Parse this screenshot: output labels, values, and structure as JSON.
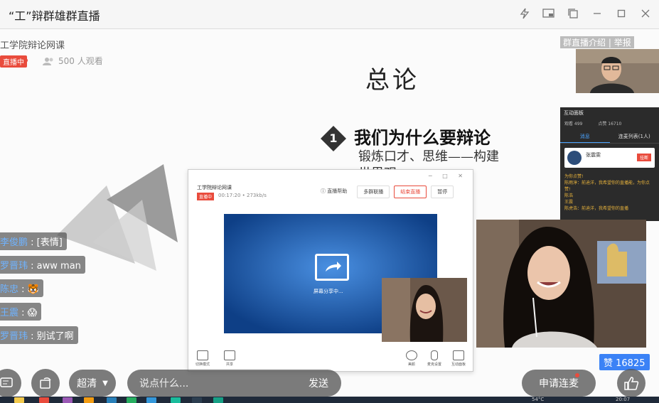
{
  "window": {
    "title": "“工”辩群雄群直播",
    "icons": [
      "flash-icon",
      "picture-in-picture-icon",
      "copy-window-icon",
      "minimize-icon",
      "maximize-icon",
      "close-icon"
    ]
  },
  "room": {
    "name": "工学院辩论网课",
    "live_badge": "直播中",
    "viewers": "500 人观看",
    "intro_link": "群直播介绍",
    "report_link": "举报"
  },
  "slide": {
    "title": "总论",
    "number": "1",
    "heading": "我们为什么要辩论",
    "subtitle": "锻炼口才、思维——构建",
    "subtitle2": "世界观"
  },
  "interact_panel": {
    "title": "互动面板",
    "viewers": "观看 499",
    "likes": "点赞 16710",
    "tab_messages": "消息",
    "tab_mic_list": "连麦列表(1人)",
    "card_name": "张震雯",
    "card_action": "挂断",
    "messages": [
      "为你点赞!",
      "陈雨淳：前迪洋，我希望你的直播能，为你点赞!",
      "陈浩",
      "王震",
      "陈虎浩：前迪洋，我希望你的直播"
    ]
  },
  "app_window": {
    "title": "工学院辩论网课",
    "badge": "直播中",
    "status": "00:17:20 • 273kb/s",
    "help": "直播帮助",
    "btn_multi": "多群联播",
    "btn_end": "结束直播",
    "btn_pause": "暂停",
    "share_text": "屏幕分享中...",
    "bottom_left": [
      "切换模式",
      "共享"
    ],
    "bottom_right": [
      "美颜",
      "麦克设置",
      "互动面板"
    ]
  },
  "chat": [
    {
      "user": "李俊鹏",
      "text": "[表情]"
    },
    {
      "user": "罗晋玮",
      "text": "aww man"
    },
    {
      "user": "陈忠",
      "text": "🐯"
    },
    {
      "user": "王震",
      "text": "😱"
    },
    {
      "user": "罗晋玮",
      "text": "别试了啊"
    }
  ],
  "likes_badge": "赞 16825",
  "controls": {
    "quality": "超清",
    "input_placeholder": "说点什么...",
    "send": "发送",
    "request_mic": "申请连麦"
  },
  "taskbar": {
    "temp": "54°C",
    "time": "20:07"
  }
}
